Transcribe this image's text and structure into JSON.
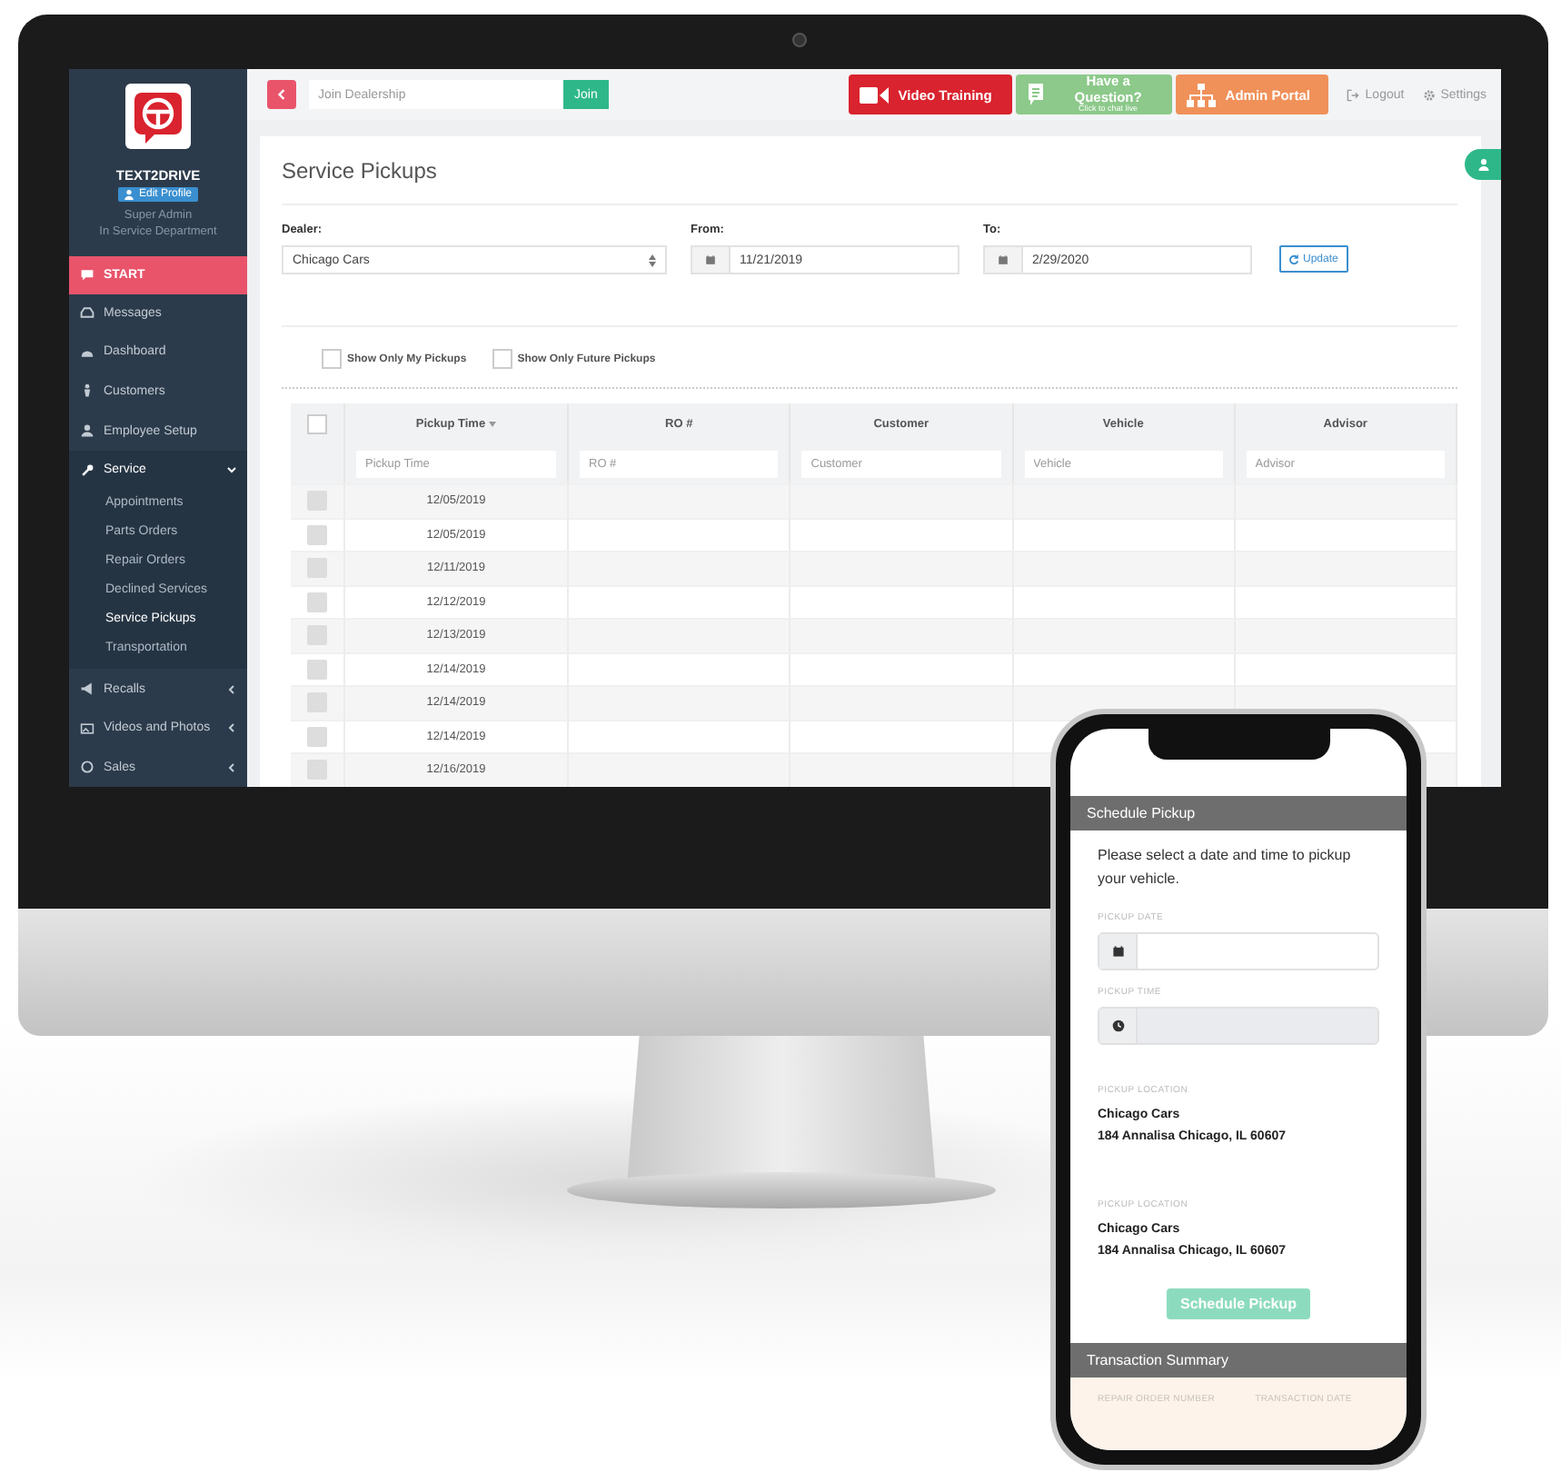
{
  "monitor": {
    "sidebar": {
      "brand": "TEXT2DRIVE",
      "profile_button": "Edit Profile",
      "role": "Super Admin",
      "department": "In Service Department",
      "items": [
        {
          "label": "START",
          "kind": "start"
        },
        {
          "label": "Messages",
          "kind": "link"
        },
        {
          "label": "Dashboard",
          "kind": "link"
        },
        {
          "label": "Customers",
          "kind": "link"
        },
        {
          "label": "Employee Setup",
          "kind": "link"
        },
        {
          "label": "Service",
          "kind": "group",
          "expanded": true,
          "children": [
            {
              "label": "Appointments",
              "selected": false
            },
            {
              "label": "Parts Orders",
              "selected": false
            },
            {
              "label": "Repair Orders",
              "selected": false
            },
            {
              "label": "Declined Services",
              "selected": false
            },
            {
              "label": "Service Pickups",
              "selected": true
            },
            {
              "label": "Transportation",
              "selected": false
            }
          ]
        },
        {
          "label": "Recalls",
          "kind": "group",
          "expanded": false
        },
        {
          "label": "Videos and Photos",
          "kind": "group",
          "expanded": false
        },
        {
          "label": "Sales",
          "kind": "group",
          "expanded": false
        }
      ]
    },
    "topbar": {
      "join_field": {
        "placeholder": "Join Dealership"
      },
      "join_button": "Join",
      "buttons": [
        {
          "kind": "video",
          "label": "Video Training"
        },
        {
          "kind": "chat",
          "label": "Have a Question?",
          "sublabel": "Click to chat live"
        },
        {
          "kind": "admin",
          "label": "Admin Portal"
        }
      ],
      "links": [
        {
          "kind": "logout",
          "label": "Logout"
        },
        {
          "kind": "settings",
          "label": "Settings"
        }
      ]
    },
    "page": {
      "title": "Service Pickups",
      "filters": {
        "dealer": {
          "label": "Dealer:",
          "value": "Chicago Cars"
        },
        "from": {
          "label": "From:",
          "value": "11/21/2019"
        },
        "to": {
          "label": "To:",
          "value": "2/29/2020"
        },
        "update_button": "Update"
      },
      "options": [
        {
          "label": "Show Only My Pickups",
          "checked": false
        },
        {
          "label": "Show Only Future Pickups",
          "checked": false
        }
      ],
      "table": {
        "select_all_checked": false,
        "columns": [
          {
            "label": "Pickup Time",
            "sorted": true,
            "filter_placeholder": "Pickup Time"
          },
          {
            "label": "RO #",
            "sorted": false,
            "filter_placeholder": "RO #"
          },
          {
            "label": "Customer",
            "sorted": false,
            "filter_placeholder": "Customer"
          },
          {
            "label": "Vehicle",
            "sorted": false,
            "filter_placeholder": "Vehicle"
          },
          {
            "label": "Advisor",
            "sorted": false,
            "filter_placeholder": "Advisor"
          }
        ],
        "rows": [
          {
            "checked": false,
            "pickup_time": "12/05/2019"
          },
          {
            "checked": false,
            "pickup_time": "12/05/2019"
          },
          {
            "checked": false,
            "pickup_time": "12/11/2019"
          },
          {
            "checked": false,
            "pickup_time": "12/12/2019"
          },
          {
            "checked": false,
            "pickup_time": "12/13/2019"
          },
          {
            "checked": false,
            "pickup_time": "12/14/2019"
          },
          {
            "checked": false,
            "pickup_time": "12/14/2019"
          },
          {
            "checked": false,
            "pickup_time": "12/14/2019"
          },
          {
            "checked": false,
            "pickup_time": "12/16/2019"
          }
        ]
      }
    }
  },
  "phone": {
    "header": "Schedule Pickup",
    "prompt": "Please select a date and time to pickup your vehicle.",
    "fields": [
      {
        "label": "PICKUP DATE",
        "kind": "date",
        "disabled": false
      },
      {
        "label": "PICKUP TIME",
        "kind": "time",
        "disabled": true
      }
    ],
    "locations": [
      {
        "label": "PICKUP LOCATION",
        "name": "Chicago Cars",
        "address": "184 Annalisa Chicago, IL 60607"
      },
      {
        "label": "PICKUP LOCATION",
        "name": "Chicago Cars",
        "address": "184 Annalisa Chicago, IL 60607"
      }
    ],
    "submit_button": {
      "label": "Schedule Pickup",
      "disabled": true
    },
    "summary": {
      "title": "Transaction Summary",
      "columns": [
        "REPAIR ORDER NUMBER",
        "TRANSACTION DATE"
      ]
    }
  }
}
